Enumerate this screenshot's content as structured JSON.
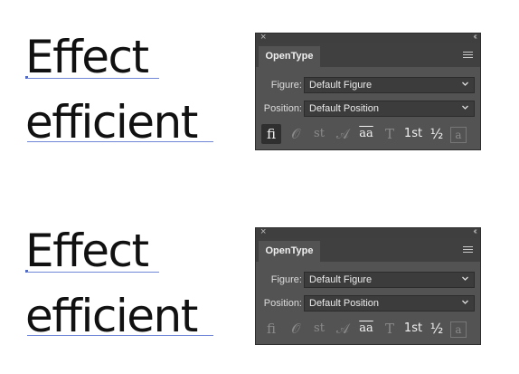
{
  "samples": [
    {
      "word1": "Effect",
      "word2": "efficient"
    },
    {
      "word1": "Effect",
      "word2": "efficient"
    }
  ],
  "panel": {
    "close_glyph": "×",
    "collapse_glyph": "‹‹",
    "tab_label": "OpenType",
    "menu_icon": "hamburger-menu-icon",
    "figure_label": "Figure:",
    "figure_value": "Default Figure",
    "position_label": "Position:",
    "position_value": "Default Position",
    "icons": [
      {
        "name": "standard-ligatures-icon",
        "glyph": "fi"
      },
      {
        "name": "contextual-alternates-icon",
        "glyph": "𝒪"
      },
      {
        "name": "discretionary-ligatures-icon",
        "glyph": "st"
      },
      {
        "name": "swash-icon",
        "glyph": "𝒜"
      },
      {
        "name": "stylistic-alternates-icon",
        "glyph": "aa"
      },
      {
        "name": "titling-alternates-icon",
        "glyph": "T"
      },
      {
        "name": "ordinals-icon",
        "glyph": "1st"
      },
      {
        "name": "fractions-icon",
        "glyph": "½"
      },
      {
        "name": "stylistic-sets-icon",
        "glyph": "a"
      }
    ]
  },
  "panels_state": [
    {
      "ligatures_selected": true
    },
    {
      "ligatures_selected": false
    }
  ],
  "colors": {
    "panel_bg": "#535353",
    "tab_bar_bg": "#404040",
    "dropdown_bg": "#3c3c3c",
    "underline_blue": "#6f87d6"
  }
}
